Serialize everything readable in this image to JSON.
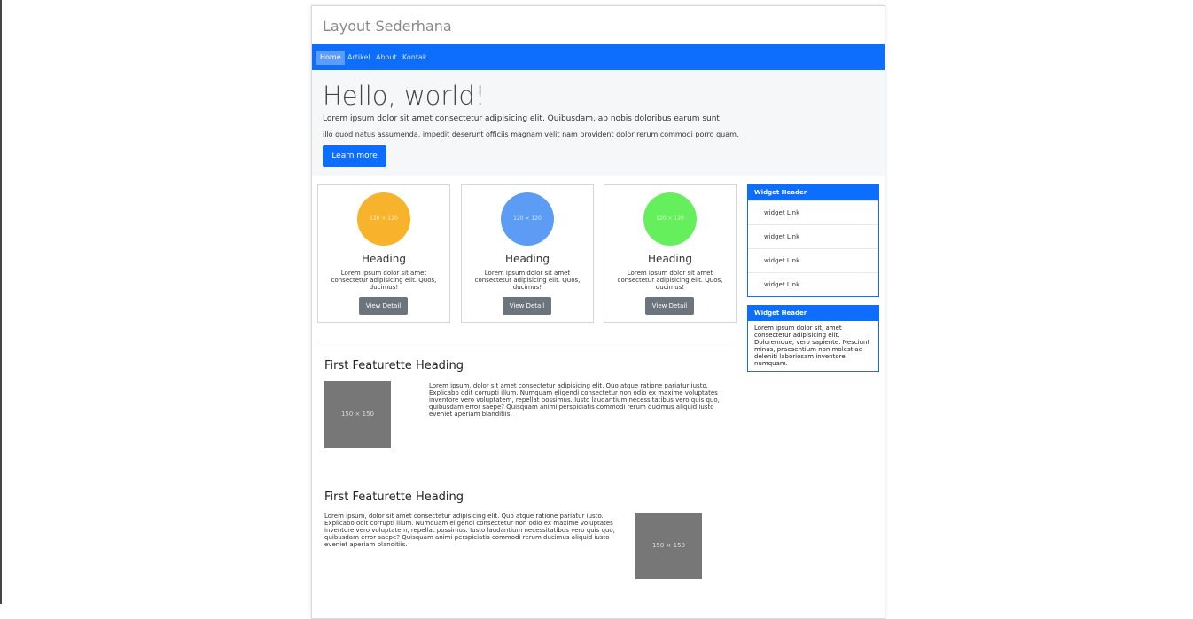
{
  "brand": "Layout Sederhana",
  "nav": {
    "items": [
      "Home",
      "Artikel",
      "About",
      "Kontak"
    ]
  },
  "jumbotron": {
    "title": "Hello, world!",
    "lead_line1": "Lorem ipsum dolor sit amet consectetur adipisicing elit. Quibusdam, ab nobis doloribus earum sunt",
    "lead_line2": "illo quod natus assumenda, impedit deserunt officiis magnam velit nam provident dolor rerum commodi porro quam.",
    "button": "Learn more"
  },
  "cards": [
    {
      "placeholder": "120 × 120",
      "color": "#f7b32b",
      "heading": "Heading",
      "text": "Lorem ipsum dolor sit amet consectetur adipisicing elit. Quos, ducimus!",
      "button": "View Detail"
    },
    {
      "placeholder": "120 × 120",
      "color": "#5c9cf5",
      "heading": "Heading",
      "text": "Lorem ipsum dolor sit amet consectetur adipisicing elit. Quos, ducimus!",
      "button": "View Detail"
    },
    {
      "placeholder": "120 × 120",
      "color": "#66ef5c",
      "heading": "Heading",
      "text": "Lorem ipsum dolor sit amet consectetur adipisicing elit. Quos, ducimus!",
      "button": "View Detail"
    }
  ],
  "featurettes": [
    {
      "heading": "First Featurette Heading",
      "placeholder": "150 × 150",
      "text": "Lorem ipsum, dolor sit amet consectetur adipisicing elit. Quo atque ratione pariatur iusto. Explicabo odit corrupti illum. Numquam eligendi consectetur non odio ex maxime voluptates inventore vero voluptatem, repellat possimus. Iusto laudantium necessitatibus vero quis quo, quibusdam error saepe? Quisquam animi perspiciatis commodi rerum ducimus aliquid iusto eveniet aperiam blanditiis."
    },
    {
      "heading": "First Featurette Heading",
      "placeholder": "150 × 150",
      "text": "Lorem ipsum, dolor sit amet consectetur adipisicing elit. Quo atque ratione pariatur iusto. Explicabo odit corrupti illum. Numquam eligendi consectetur non odio ex maxime voluptates inventore vero voluptatem, repellat possimus. Iusto laudantium necessitatibus vero quis quo, quibusdam error saepe? Quisquam animi perspiciatis commodi rerum ducimus aliquid iusto eveniet aperiam blanditiis."
    }
  ],
  "widgets": [
    {
      "header": "Widget Header",
      "links": [
        "widget Link",
        "widget Link",
        "widget Link",
        "widget Link"
      ]
    },
    {
      "header": "Widget Header",
      "body": "Lorem ipsum dolor sit, amet consectetur adipisicing elit. Doloremque, vero sapiente. Nesciunt minus, praesentium non molestiae deleniti laboriosam inventore numquam."
    }
  ],
  "colors": {
    "primary": "#0d6efd",
    "secondary": "#6c757d",
    "placeholder": "#777777"
  }
}
